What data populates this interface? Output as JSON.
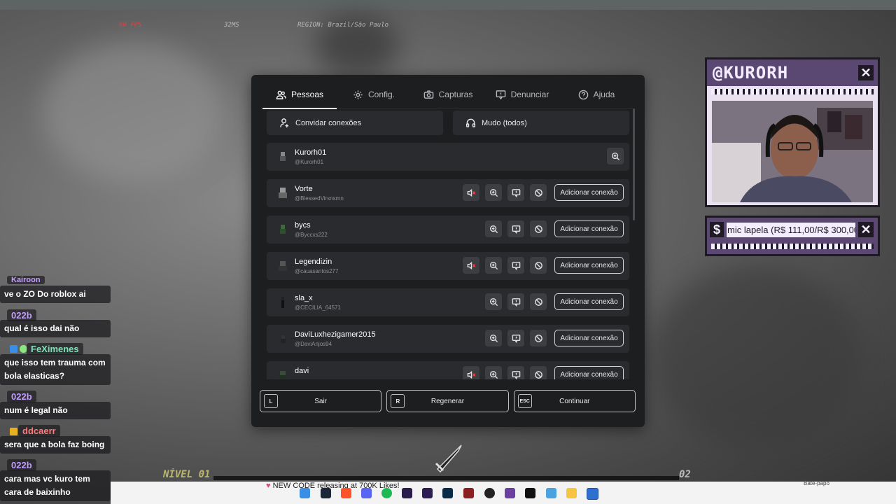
{
  "hud": {
    "fps": "60 FPS",
    "ping": "32MS",
    "region": "REGION: Brazil/São Paulo"
  },
  "tabs": [
    {
      "label": "Pessoas",
      "icon": "people-icon",
      "active": true
    },
    {
      "label": "Config.",
      "icon": "gear-icon",
      "active": false
    },
    {
      "label": "Capturas",
      "icon": "camera-icon",
      "active": false
    },
    {
      "label": "Denunciar",
      "icon": "report-flag-icon",
      "active": false
    },
    {
      "label": "Ajuda",
      "icon": "help-icon",
      "active": false
    }
  ],
  "actions": {
    "invite": "Convidar conexões",
    "mute": "Mudo (todos)"
  },
  "players": [
    {
      "name": "Kurorh01",
      "handle": "@Kurorh01",
      "self": true
    },
    {
      "name": "Vorte",
      "handle": "@BlessedVirsnsmn",
      "muted": true,
      "add": "Adicionar conexão"
    },
    {
      "name": "bycs",
      "handle": "@Byccxs222",
      "muted": false,
      "add": "Adicionar conexão"
    },
    {
      "name": "Legendizin",
      "handle": "@cauasantos277",
      "muted": true,
      "add": "Adicionar conexão"
    },
    {
      "name": "sla_x",
      "handle": "@CECILIA_64571",
      "muted": false,
      "add": "Adicionar conexão"
    },
    {
      "name": "DaviLuxhezigamer2015",
      "handle": "@DaviAnjos94",
      "muted": false,
      "add": "Adicionar conexão"
    },
    {
      "name": "davi",
      "handle": "",
      "muted": true,
      "add": "Adicionar conexão"
    }
  ],
  "footer": {
    "leave": {
      "key": "L",
      "label": "Sair"
    },
    "reset": {
      "key": "R",
      "label": "Regenerar"
    },
    "resume": {
      "key": "ESC",
      "label": "Continuar"
    }
  },
  "overlay": {
    "streamer": "@KURORH",
    "donation": "mic lapela (R$ 111,00/R$ 300,00",
    "donation_symbol": "$"
  },
  "chat": [
    {
      "user": "Kairoon",
      "text": "ve o ZO Do roblox ai"
    },
    {
      "user": "022b",
      "text": "qual é isso dai não"
    },
    {
      "user": "FeXimenes",
      "text": "que isso tem trauma com bola elasticas?"
    },
    {
      "user": "022b",
      "text": "num é legal não"
    },
    {
      "user": "ddcaerr",
      "text": "sera que a bola faz boing"
    },
    {
      "user": "022b",
      "text": "cara mas vc kuro tem cara de baixinho"
    }
  ],
  "game_hud": {
    "level": "NÍVEL 01",
    "next_level": "02"
  },
  "taskbar": {
    "ticker": "NEW CODE releasing at 700K Likes!",
    "chat_label": "Bate-papo"
  },
  "colors": {
    "modal_bg": "#1d1e20",
    "row_bg": "#2a2b2e",
    "overlay_purple": "#5a4873",
    "chat_name": "#c29cff",
    "fps_red": "#ff3b3b"
  }
}
